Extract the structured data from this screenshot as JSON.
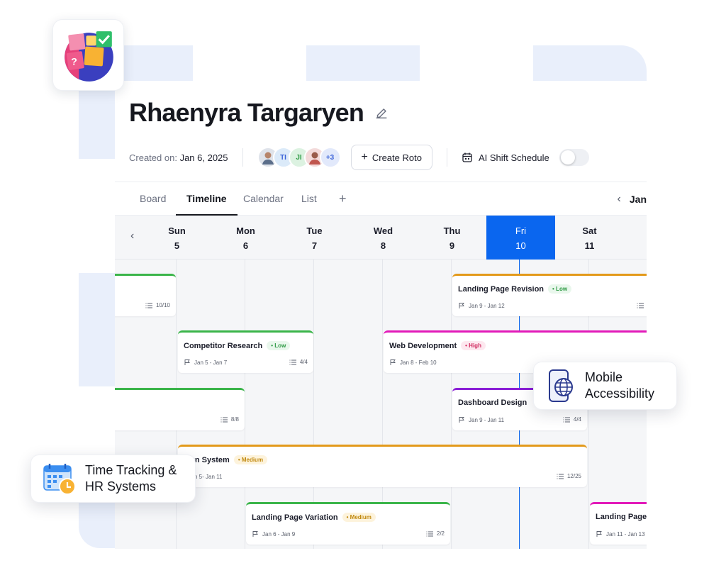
{
  "colors": {
    "accent": "#0a66ef",
    "green": "#3bb54a",
    "magenta": "#e21ab9",
    "orange": "#e39a1b",
    "purple": "#8a1ed6"
  },
  "project": {
    "title": "Rhaenyra Targaryen",
    "created_label": "Created on:",
    "created_date": "Jan 6, 2025"
  },
  "avatars": [
    {
      "initials": "",
      "color": "#dfe3ea"
    },
    {
      "initials": "TI",
      "color": "#dbeaf9"
    },
    {
      "initials": "JI",
      "color": "#dcf2e1"
    },
    {
      "initials": "",
      "color": "#f3dada"
    },
    {
      "initials": "+3",
      "color": "#e2e9fb"
    }
  ],
  "toolbar": {
    "create_label": "Create Roto",
    "ai_shift_label": "AI Shift Schedule",
    "ai_shift_enabled": false
  },
  "tabs": [
    "Board",
    "Timeline",
    "Calendar",
    "List"
  ],
  "active_tab": "Timeline",
  "month_label": "Jan",
  "days": [
    {
      "name": "Sun",
      "num": "5"
    },
    {
      "name": "Mon",
      "num": "6"
    },
    {
      "name": "Tue",
      "num": "7"
    },
    {
      "name": "Wed",
      "num": "8"
    },
    {
      "name": "Thu",
      "num": "9"
    },
    {
      "name": "Fri",
      "num": "10"
    },
    {
      "name": "Sat",
      "num": "11"
    }
  ],
  "today_index": 5,
  "tasks": [
    {
      "name": "",
      "priority": "",
      "dates": "",
      "count": "10/10",
      "color": "green"
    },
    {
      "name": "Landing Page Revision",
      "priority": "Low",
      "dates": "Jan 9 - Jan 12",
      "count": "6/",
      "color": "orange"
    },
    {
      "name": "Competitor Research",
      "priority": "Low",
      "dates": "Jan 5 - Jan 7",
      "count": "4/4",
      "color": "green"
    },
    {
      "name": "Web Development",
      "priority": "High",
      "dates": "Jan 8 - Feb 10",
      "count": "",
      "color": "magenta"
    },
    {
      "name": "",
      "priority": "",
      "dates": "",
      "count": "8/8",
      "color": "green"
    },
    {
      "name": "Dashboard Design",
      "priority": "",
      "dates": "Jan 9 - Jan 11",
      "count": "4/4",
      "color": "purple"
    },
    {
      "name": "sign System",
      "priority": "Medium",
      "dates": "n 5- Jan 11",
      "count": "12/25",
      "color": "orange"
    },
    {
      "name": "Landing Page Variation",
      "priority": "Medium",
      "dates": "Jan 6 - Jan 9",
      "count": "2/2",
      "color": "green"
    },
    {
      "name": "Landing Page A",
      "priority": "",
      "dates": "Jan 11 - Jan 13",
      "count": "",
      "color": "magenta"
    }
  ],
  "callouts": {
    "mobile": {
      "line1": "Mobile",
      "line2": "Accessibility",
      "icon": "mobile-globe-icon"
    },
    "time": {
      "line1": "Time Tracking &",
      "line2": "HR Systems",
      "icon": "calendar-clock-icon"
    }
  },
  "app_icon": "sticky-notes-logo"
}
